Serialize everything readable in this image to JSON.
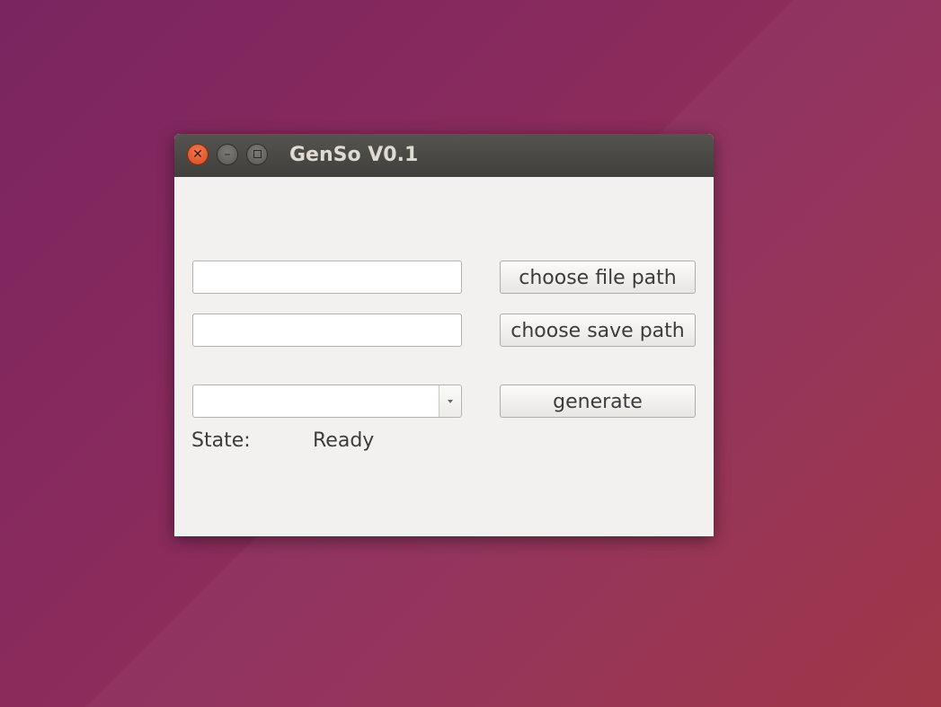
{
  "window": {
    "title": "GenSo V0.1",
    "controls": {
      "close_glyph": "✕",
      "minimize_glyph": "–"
    }
  },
  "form": {
    "file_path": {
      "value": "",
      "placeholder": ""
    },
    "save_path": {
      "value": "",
      "placeholder": ""
    },
    "dropdown": {
      "selected": ""
    },
    "choose_file_button": "choose file path",
    "choose_save_button": "choose save path",
    "generate_button": "generate",
    "state_label": "State:",
    "state_value": "Ready"
  },
  "colors": {
    "titlebar": "#403f3b",
    "window_bg": "#f2f1f0",
    "close_button": "#e05a2a",
    "title_text": "#dfdbd2"
  },
  "icons": {
    "close": "close-icon",
    "minimize": "minimize-icon",
    "maximize": "maximize-icon",
    "dropdown_arrow": "chevron-down-icon"
  }
}
